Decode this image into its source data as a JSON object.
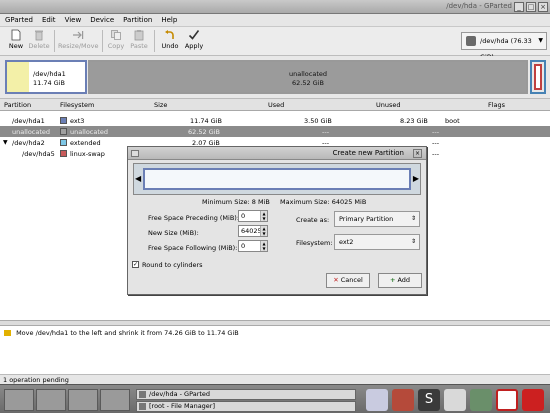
{
  "window": {
    "title": "/dev/hda - GParted"
  },
  "menu": [
    "GParted",
    "Edit",
    "View",
    "Device",
    "Partition",
    "Help"
  ],
  "toolbar": {
    "new": "New",
    "delete": "Delete",
    "resize_move": "Resize/Move",
    "copy": "Copy",
    "paste": "Paste",
    "undo": "Undo",
    "apply": "Apply",
    "device": "/dev/hda",
    "device_size": "(76.33 GiB)"
  },
  "map": {
    "seg1_name": "/dev/hda1",
    "seg1_size": "11.74 GiB",
    "seg2_name": "unallocated",
    "seg2_size": "62.52 GiB"
  },
  "table": {
    "headers": [
      "Partition",
      "Filesystem",
      "Size",
      "Used",
      "Unused",
      "Flags"
    ],
    "rows": [
      {
        "partition": "/dev/hda1",
        "filesystem": "ext3",
        "size": "11.74 GiB",
        "used": "3.50 GiB",
        "unused": "8.23 GiB",
        "flags": "boot",
        "color": "#6b7fb5"
      },
      {
        "partition": "unallocated",
        "filesystem": "unallocated",
        "size": "62.52 GiB",
        "used": "---",
        "unused": "---",
        "flags": "",
        "color": "#a0a0a0"
      },
      {
        "partition": "/dev/hda2",
        "filesystem": "extended",
        "size": "2.07 GiB",
        "used": "---",
        "unused": "---",
        "flags": "",
        "color": "#7ec7e6"
      },
      {
        "partition": "/dev/hda5",
        "filesystem": "linux-swap",
        "size": "",
        "used": "",
        "unused": "---",
        "flags": "",
        "color": "#c85a5a"
      }
    ]
  },
  "dialog": {
    "title": "Create new Partition",
    "min_size": "Minimum Size: 8 MiB",
    "max_size": "Maximum Size: 64025 MiB",
    "free_preceding_label": "Free Space Preceding (MiB):",
    "free_preceding_value": "0",
    "new_size_label": "New Size (MiB):",
    "new_size_value": "64025",
    "free_following_label": "Free Space Following (MiB):",
    "free_following_value": "0",
    "create_as_label": "Create as:",
    "create_as_value": "Primary Partition",
    "filesystem_label": "Filesystem:",
    "filesystem_value": "ext2",
    "round_label": "Round to cylinders",
    "cancel": "Cancel",
    "add": "Add"
  },
  "log": {
    "operation": "Move /dev/hda1 to the left and shrink it from 74.26 GiB to 11.74 GiB",
    "status": "1 operation pending"
  },
  "taskbar": {
    "task1": "/dev/hda - GParted",
    "task2": "[root - File Manager]"
  }
}
